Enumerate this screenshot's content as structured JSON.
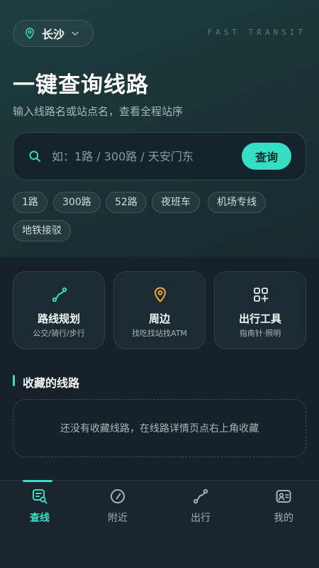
{
  "header": {
    "city": "长沙",
    "brand": "FAST TRANSIT",
    "title": "一键查询线路",
    "subtitle": "输入线路名或站点名，查看全程站序"
  },
  "search": {
    "placeholder": "如：1路 / 300路 / 天安门东",
    "value": "",
    "button_label": "查询"
  },
  "quick_chips": [
    "1路",
    "300路",
    "52路",
    "夜班车",
    "机场专线",
    "地铁接驳"
  ],
  "feature_cards": [
    {
      "title": "路线规划",
      "subtitle": "公交/骑行/步行",
      "icon": "route-icon"
    },
    {
      "title": "周边",
      "subtitle": "找吃找站找ATM",
      "icon": "location-pin-icon"
    },
    {
      "title": "出行工具",
      "subtitle": "指南针·照明",
      "icon": "grid-plus-icon"
    }
  ],
  "favorites": {
    "title": "收藏的线路",
    "empty_text": "还没有收藏线路，在线路详情页点右上角收藏"
  },
  "tabs": [
    {
      "label": "查线",
      "icon": "search-list-icon",
      "active": true
    },
    {
      "label": "附近",
      "icon": "compass-icon",
      "active": false
    },
    {
      "label": "出行",
      "icon": "route-icon",
      "active": false
    },
    {
      "label": "我的",
      "icon": "profile-card-icon",
      "active": false
    }
  ],
  "colors": {
    "accent": "#35dfc6",
    "pin_orange": "#f2a93b",
    "background": "#17212a",
    "hero": "#1f3d3f"
  }
}
